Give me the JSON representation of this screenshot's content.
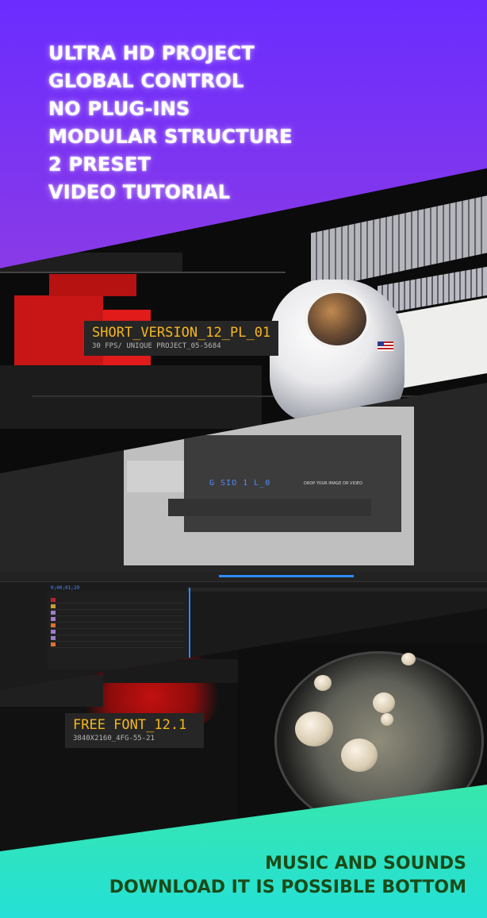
{
  "features": [
    "ULTRA HD PROJECT",
    "GLOBAL CONTROL",
    "NO PLUG-INS",
    "MODULAR STRUCTURE",
    "2 PRESET",
    "VIDEO TUTORIAL"
  ],
  "preview_top": {
    "title": "SHORT_VERSION_12_PL_01",
    "subtitle": "30 FPS/ UNIQUE PROJECT_05-5684"
  },
  "composition": {
    "glitch_text": "G   SIO 1 L_0",
    "drop_text": "DROP YOUR IMAGE OR VIDEO",
    "timecode": "0;00;01;29"
  },
  "preview_bottom": {
    "title": "FREE FONT_12.1",
    "subtitle": "3840X2160_4FG-55-21"
  },
  "footer": {
    "line1": "MUSIC AND SOUNDS",
    "line2": "DOWNLOAD IT IS POSSIBLE BOTTOM"
  },
  "colors": {
    "accent_yellow": "#f6b71d",
    "timeline_blue": "#2d8cff",
    "top_gradient_start": "#6b2cff",
    "top_gradient_end": "#ff8a12",
    "bottom_gradient_start": "#7dff2b",
    "bottom_gradient_end": "#24e0d7"
  }
}
